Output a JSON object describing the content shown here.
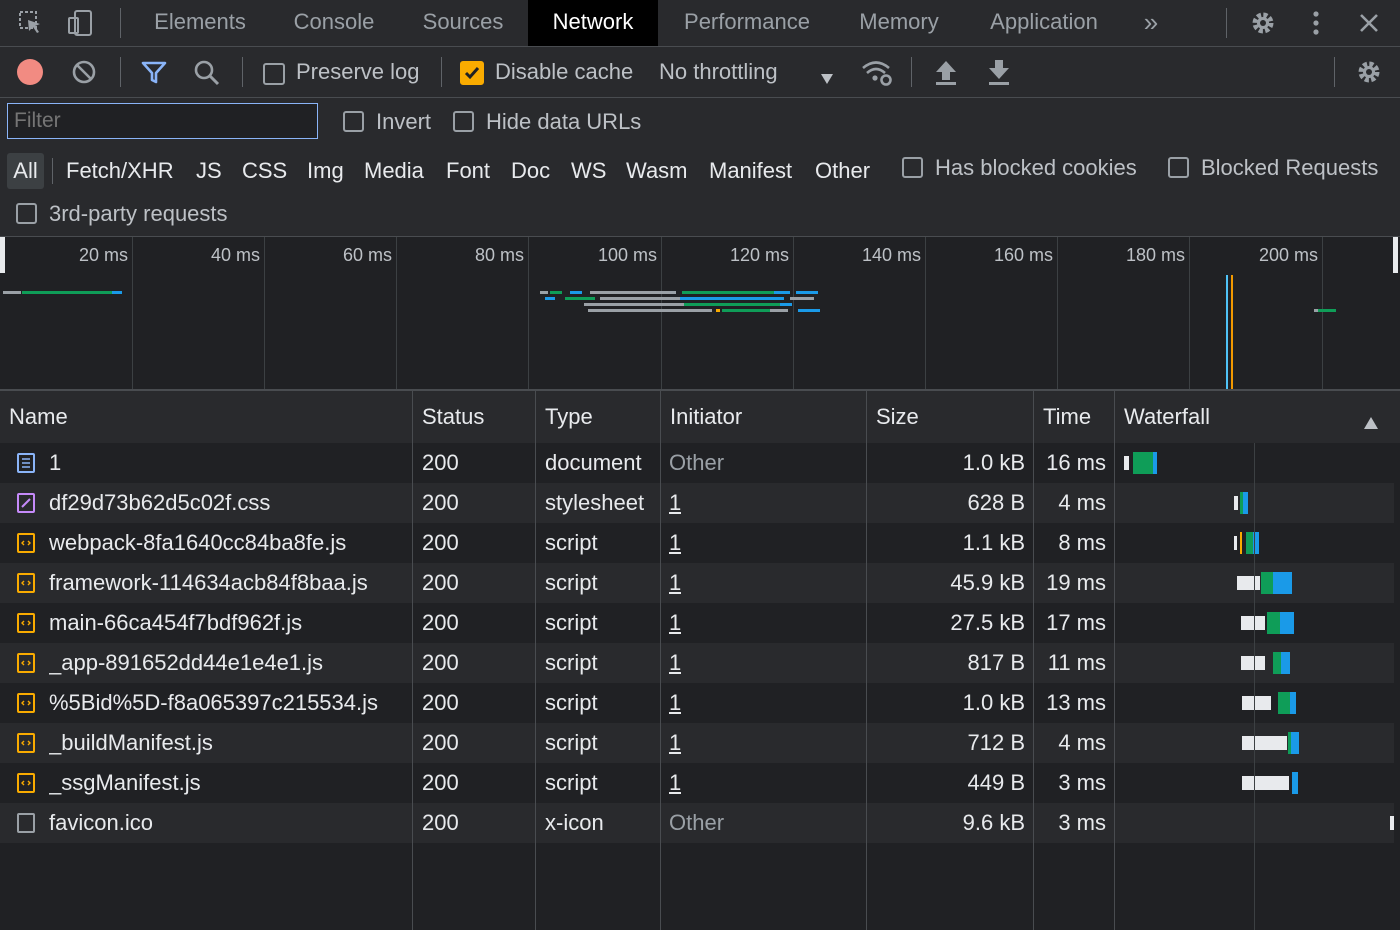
{
  "tabs": [
    {
      "label": "Elements"
    },
    {
      "label": "Console"
    },
    {
      "label": "Sources"
    },
    {
      "label": "Network",
      "active": true
    },
    {
      "label": "Performance"
    },
    {
      "label": "Memory"
    },
    {
      "label": "Application"
    }
  ],
  "more_tabs": "»",
  "toolbar": {
    "preserve_log": "Preserve log",
    "disable_cache": "Disable cache",
    "throttling": "No throttling"
  },
  "filter": {
    "placeholder": "Filter",
    "invert": "Invert",
    "hide_data_urls": "Hide data URLs",
    "types": [
      "All",
      "Fetch/XHR",
      "JS",
      "CSS",
      "Img",
      "Media",
      "Font",
      "Doc",
      "WS",
      "Wasm",
      "Manifest",
      "Other"
    ],
    "has_blocked_cookies": "Has blocked cookies",
    "blocked_requests": "Blocked Requests",
    "third_party": "3rd-party requests"
  },
  "overview": {
    "ticks": [
      "20 ms",
      "40 ms",
      "60 ms",
      "80 ms",
      "100 ms",
      "120 ms",
      "140 ms",
      "160 ms",
      "180 ms",
      "200 ms"
    ]
  },
  "columns": {
    "name": "Name",
    "status": "Status",
    "type": "Type",
    "initiator": "Initiator",
    "size": "Size",
    "time": "Time",
    "waterfall": "Waterfall"
  },
  "requests": [
    {
      "name": "1",
      "status": "200",
      "type": "document",
      "initiator": "Other",
      "size": "1.0 kB",
      "time": "16 ms",
      "icon": "document-icon"
    },
    {
      "name": "df29d73b62d5c02f.css",
      "status": "200",
      "type": "stylesheet",
      "initiator": "1",
      "size": "628 B",
      "time": "4 ms",
      "icon": "stylesheet-icon"
    },
    {
      "name": "webpack-8fa1640cc84ba8fe.js",
      "status": "200",
      "type": "script",
      "initiator": "1",
      "size": "1.1 kB",
      "time": "8 ms",
      "icon": "script-icon"
    },
    {
      "name": "framework-114634acb84f8baa.js",
      "status": "200",
      "type": "script",
      "initiator": "1",
      "size": "45.9 kB",
      "time": "19 ms",
      "icon": "script-icon"
    },
    {
      "name": "main-66ca454f7bdf962f.js",
      "status": "200",
      "type": "script",
      "initiator": "1",
      "size": "27.5 kB",
      "time": "17 ms",
      "icon": "script-icon"
    },
    {
      "name": "_app-891652dd44e1e4e1.js",
      "status": "200",
      "type": "script",
      "initiator": "1",
      "size": "817 B",
      "time": "11 ms",
      "icon": "script-icon"
    },
    {
      "name": "%5Bid%5D-f8a065397c215534.js",
      "status": "200",
      "type": "script",
      "initiator": "1",
      "size": "1.0 kB",
      "time": "13 ms",
      "icon": "script-icon"
    },
    {
      "name": "_buildManifest.js",
      "status": "200",
      "type": "script",
      "initiator": "1",
      "size": "712 B",
      "time": "4 ms",
      "icon": "script-icon"
    },
    {
      "name": "_ssgManifest.js",
      "status": "200",
      "type": "script",
      "initiator": "1",
      "size": "449 B",
      "time": "3 ms",
      "icon": "script-icon"
    },
    {
      "name": "favicon.ico",
      "status": "200",
      "type": "x-icon",
      "initiator": "Other",
      "size": "9.6 kB",
      "time": "3 ms",
      "icon": "file-icon"
    }
  ],
  "colors": {
    "accent_blue": "#8ab4f8",
    "record_red": "#f28b82",
    "checkbox_orange": "#f9ab00",
    "waterfall_green": "#0f9d58",
    "waterfall_blue": "#1a9ae8"
  }
}
